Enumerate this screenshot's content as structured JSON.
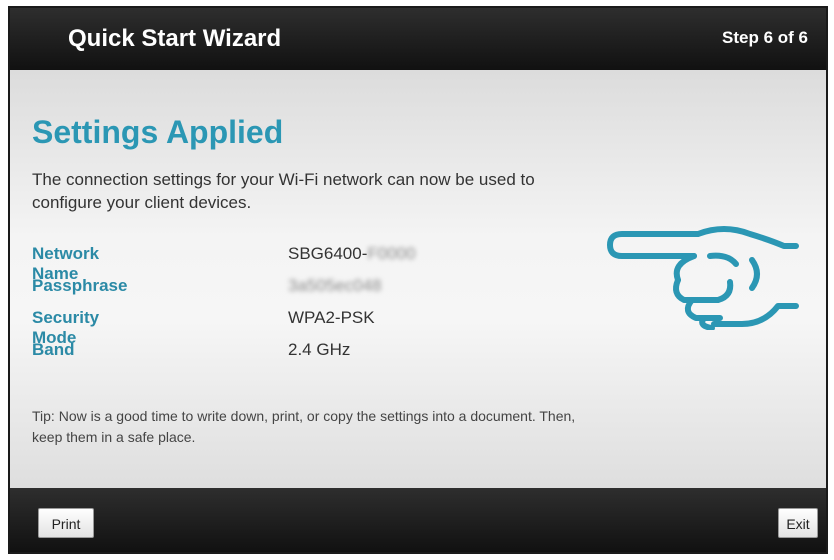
{
  "header": {
    "title": "Quick Start Wizard",
    "step": "Step 6 of 6"
  },
  "main": {
    "heading": "Settings Applied",
    "intro": "The connection settings for your Wi-Fi network can now be used to configure your client devices.",
    "settings": [
      {
        "label": "Network Name",
        "value": "SBG6400-",
        "redacted_suffix": "F0000"
      },
      {
        "label": "Passphrase",
        "value": "3a505ec048",
        "redacted": true
      },
      {
        "label": "Security Mode",
        "value": "WPA2-PSK"
      },
      {
        "label": "Band",
        "value": "2.4 GHz"
      }
    ],
    "tip": "Tip: Now is a good time to write down, print, or copy the settings into a document. Then, keep them in a safe place.",
    "illustration": "pointing-hand-icon",
    "accent_color": "#2b97b4"
  },
  "footer": {
    "print_label": "Print",
    "exit_label": "Exit"
  }
}
